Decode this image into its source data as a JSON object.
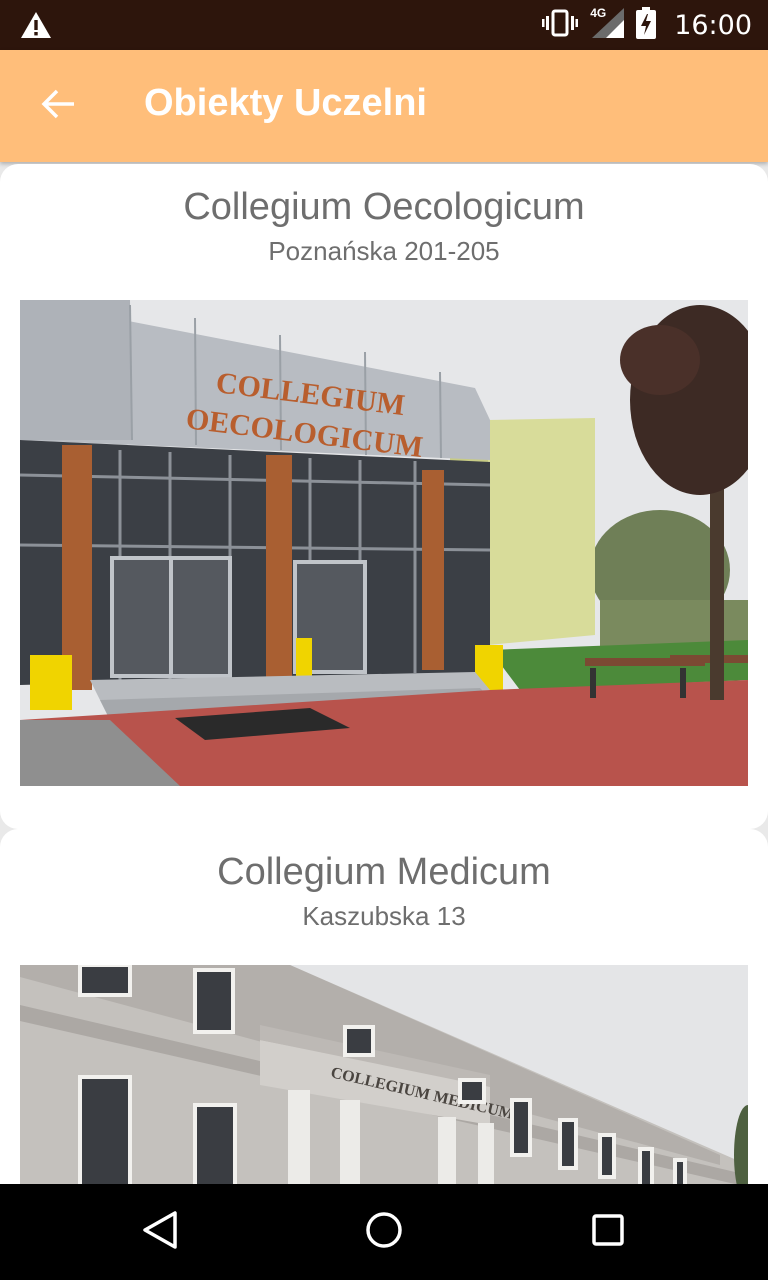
{
  "status_bar": {
    "time": "16:00",
    "network": "4G",
    "icons": [
      "warning-icon",
      "vibrate-icon",
      "signal-icon",
      "battery-charging-icon"
    ]
  },
  "app_bar": {
    "title": "Obiekty Uczelni",
    "back_icon": "arrow-back-icon"
  },
  "buildings": [
    {
      "name": "Collegium Oecologicum",
      "address": "Poznańska 201-205",
      "sign_line1": "COLLEGIUM",
      "sign_line2": "OECOLOGICUM"
    },
    {
      "name": "Collegium Medicum",
      "address": "Kaszubska 13",
      "sign": "COLLEGIUM MEDICUM"
    }
  ],
  "nav_bar": {
    "icons": [
      "back-triangle-icon",
      "home-circle-icon",
      "recents-square-icon"
    ]
  },
  "colors": {
    "app_bar": "#ffbe7a",
    "status_bar": "#2d150c",
    "text_secondary": "#6e6e6e"
  }
}
